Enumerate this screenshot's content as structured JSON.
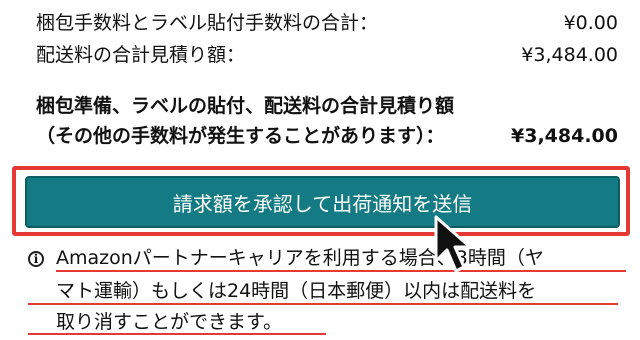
{
  "summary": {
    "packing_label": "梱包手数料とラベル貼付手数料の合計：",
    "packing_value": "¥0.00",
    "shipping_label": "配送料の合計見積り額：",
    "shipping_value": "¥3,484.00",
    "total_label_line1": "梱包準備、ラベルの貼付、配送料の合計見積り額",
    "total_label_line2": "（その他の手数料が発生することがあります）：",
    "total_value": "¥3,484.00"
  },
  "action": {
    "submit_label": "請求額を承認して出荷通知を送信"
  },
  "notice": {
    "line1": "Amazonパートナーキャリアを利用する場合、3時間（ヤ",
    "line2": "マト運輸）もしくは24時間（日本郵便）以内は配送料を",
    "line3": "取り消すことができます。"
  },
  "colors": {
    "button_bg": "#147b84",
    "highlight": "#e53935"
  },
  "icons": {
    "info": "info-circle-icon",
    "cursor": "mouse-pointer-icon"
  }
}
